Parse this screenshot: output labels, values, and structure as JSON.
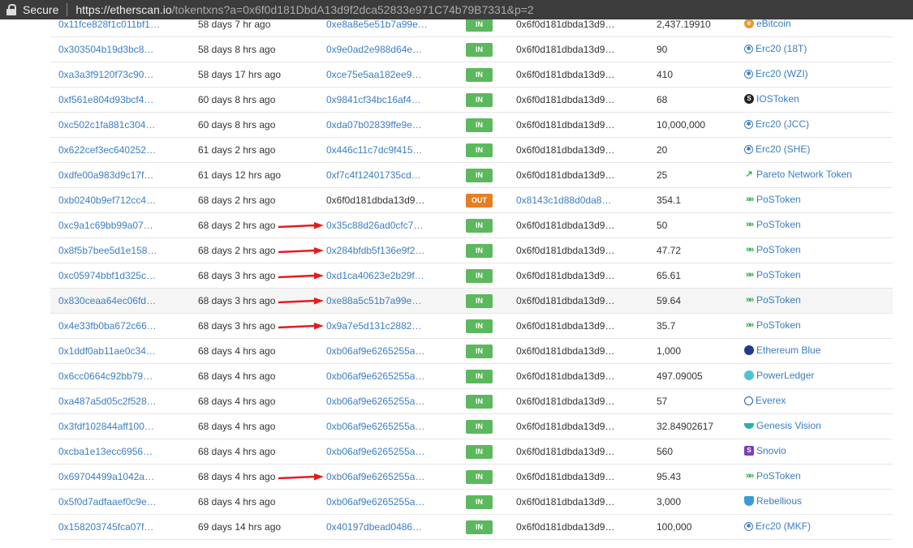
{
  "browser": {
    "secure_label": "Secure",
    "url_host": "https://etherscan.io",
    "url_path": "/tokentxns?a=0x6f0d181DbdA13d9f2dca52833e971C74b79B7331&p=2"
  },
  "transactions": [
    {
      "hash": "0x11fce828f1c011bf1…",
      "age": "58 days 7 hr ago",
      "from": "0xe8a8e5e51b7a99e…",
      "from_link": true,
      "dir": "IN",
      "to": "0x6f0d181dbda13d9…",
      "to_link": false,
      "value": "2,437.19910",
      "token": "eBitcoin",
      "icon": "ebitcoin-icon",
      "arrow": false,
      "hl": false
    },
    {
      "hash": "0x303504b19d3bc8…",
      "age": "58 days 8 hrs ago",
      "from": "0x9e0ad2e988d64e…",
      "from_link": true,
      "dir": "IN",
      "to": "0x6f0d181dbda13d9…",
      "to_link": false,
      "value": "90",
      "token": "Erc20 (18T)",
      "icon": "erc20-icon",
      "arrow": false,
      "hl": false
    },
    {
      "hash": "0xa3a3f9120f73c90…",
      "age": "58 days 17 hrs ago",
      "from": "0xce75e5aa182ee9…",
      "from_link": true,
      "dir": "IN",
      "to": "0x6f0d181dbda13d9…",
      "to_link": false,
      "value": "410",
      "token": "Erc20 (WZI)",
      "icon": "erc20-icon",
      "arrow": false,
      "hl": false
    },
    {
      "hash": "0xf561e804d93bcf4…",
      "age": "60 days 8 hrs ago",
      "from": "0x9841cf34bc16af4…",
      "from_link": true,
      "dir": "IN",
      "to": "0x6f0d181dbda13d9…",
      "to_link": false,
      "value": "68",
      "token": "IOSToken",
      "icon": "iostoken-icon",
      "arrow": false,
      "hl": false
    },
    {
      "hash": "0xc502c1fa881c304…",
      "age": "60 days 8 hrs ago",
      "from": "0xda07b02839ffe9e…",
      "from_link": true,
      "dir": "IN",
      "to": "0x6f0d181dbda13d9…",
      "to_link": false,
      "value": "10,000,000",
      "token": "Erc20 (JCC)",
      "icon": "erc20-icon",
      "arrow": false,
      "hl": false
    },
    {
      "hash": "0x622cef3ec640252…",
      "age": "61 days 2 hrs ago",
      "from": "0x446c11c7dc9f415…",
      "from_link": true,
      "dir": "IN",
      "to": "0x6f0d181dbda13d9…",
      "to_link": false,
      "value": "20",
      "token": "Erc20 (SHE)",
      "icon": "erc20-icon",
      "arrow": false,
      "hl": false
    },
    {
      "hash": "0xdfe00a983d9c17f…",
      "age": "61 days 12 hrs ago",
      "from": "0xf7c4f12401735cd…",
      "from_link": true,
      "dir": "IN",
      "to": "0x6f0d181dbda13d9…",
      "to_link": false,
      "value": "25",
      "token": "Pareto Network Token",
      "icon": "pareto-icon",
      "arrow": false,
      "hl": false
    },
    {
      "hash": "0xb0240b9ef712cc4…",
      "age": "68 days 2 hrs ago",
      "from": "0x6f0d181dbda13d9…",
      "from_link": false,
      "dir": "OUT",
      "to": "0x8143c1d88d0da8…",
      "to_link": true,
      "value": "354.1",
      "token": "PoSToken",
      "icon": "postoken-icon",
      "arrow": false,
      "hl": false
    },
    {
      "hash": "0xc9a1c69bb99a07…",
      "age": "68 days 2 hrs ago",
      "from": "0x35c88d26ad0cfc7…",
      "from_link": true,
      "dir": "IN",
      "to": "0x6f0d181dbda13d9…",
      "to_link": false,
      "value": "50",
      "token": "PoSToken",
      "icon": "postoken-icon",
      "arrow": true,
      "hl": false
    },
    {
      "hash": "0x8f5b7bee5d1e158…",
      "age": "68 days 2 hrs ago",
      "from": "0x284bfdb5f136e9f2…",
      "from_link": true,
      "dir": "IN",
      "to": "0x6f0d181dbda13d9…",
      "to_link": false,
      "value": "47.72",
      "token": "PoSToken",
      "icon": "postoken-icon",
      "arrow": true,
      "hl": false
    },
    {
      "hash": "0xc05974bbf1d325c…",
      "age": "68 days 3 hrs ago",
      "from": "0xd1ca40623e2b29f…",
      "from_link": true,
      "dir": "IN",
      "to": "0x6f0d181dbda13d9…",
      "to_link": false,
      "value": "65.61",
      "token": "PoSToken",
      "icon": "postoken-icon",
      "arrow": true,
      "hl": false
    },
    {
      "hash": "0x830ceaa64ec06fd…",
      "age": "68 days 3 hrs ago",
      "from": "0xe88a5c51b7a99e…",
      "from_link": true,
      "dir": "IN",
      "to": "0x6f0d181dbda13d9…",
      "to_link": false,
      "value": "59.64",
      "token": "PoSToken",
      "icon": "postoken-icon",
      "arrow": true,
      "hl": true
    },
    {
      "hash": "0x4e33fb0ba672c66…",
      "age": "68 days 3 hrs ago",
      "from": "0x9a7e5d131c2882…",
      "from_link": true,
      "dir": "IN",
      "to": "0x6f0d181dbda13d9…",
      "to_link": false,
      "value": "35.7",
      "token": "PoSToken",
      "icon": "postoken-icon",
      "arrow": true,
      "hl": false
    },
    {
      "hash": "0x1ddf0ab11ae0c34…",
      "age": "68 days 4 hrs ago",
      "from": "0xb06af9e6265255a…",
      "from_link": true,
      "dir": "IN",
      "to": "0x6f0d181dbda13d9…",
      "to_link": false,
      "value": "1,000",
      "token": "Ethereum Blue",
      "icon": "ethereum-blue-icon",
      "arrow": false,
      "hl": false
    },
    {
      "hash": "0x6cc0664c92bb79…",
      "age": "68 days 4 hrs ago",
      "from": "0xb06af9e6265255a…",
      "from_link": true,
      "dir": "IN",
      "to": "0x6f0d181dbda13d9…",
      "to_link": false,
      "value": "497.09005",
      "token": "PowerLedger",
      "icon": "powerledger-icon",
      "arrow": false,
      "hl": false
    },
    {
      "hash": "0xa487a5d05c2f528…",
      "age": "68 days 4 hrs ago",
      "from": "0xb06af9e6265255a…",
      "from_link": true,
      "dir": "IN",
      "to": "0x6f0d181dbda13d9…",
      "to_link": false,
      "value": "57",
      "token": "Everex",
      "icon": "everex-icon",
      "arrow": false,
      "hl": false
    },
    {
      "hash": "0x3fdf102844aff100…",
      "age": "68 days 4 hrs ago",
      "from": "0xb06af9e6265255a…",
      "from_link": true,
      "dir": "IN",
      "to": "0x6f0d181dbda13d9…",
      "to_link": false,
      "value": "32.84902617",
      "token": "Genesis Vision",
      "icon": "genesis-vision-icon",
      "arrow": false,
      "hl": false
    },
    {
      "hash": "0xcba1e13ecc6956…",
      "age": "68 days 4 hrs ago",
      "from": "0xb06af9e6265255a…",
      "from_link": true,
      "dir": "IN",
      "to": "0x6f0d181dbda13d9…",
      "to_link": false,
      "value": "560",
      "token": "Snovio",
      "icon": "snovio-icon",
      "arrow": false,
      "hl": false
    },
    {
      "hash": "0x69704499a1042a…",
      "age": "68 days 4 hrs ago",
      "from": "0xb06af9e6265255a…",
      "from_link": true,
      "dir": "IN",
      "to": "0x6f0d181dbda13d9…",
      "to_link": false,
      "value": "95.43",
      "token": "PoSToken",
      "icon": "postoken-icon",
      "arrow": true,
      "hl": false
    },
    {
      "hash": "0x5f0d7adfaaef0c9e…",
      "age": "68 days 4 hrs ago",
      "from": "0xb06af9e6265255a…",
      "from_link": true,
      "dir": "IN",
      "to": "0x6f0d181dbda13d9…",
      "to_link": false,
      "value": "3,000",
      "token": "Rebellious",
      "icon": "rebellious-icon",
      "arrow": false,
      "hl": false
    },
    {
      "hash": "0x158203745fca07f…",
      "age": "69 days 14 hrs ago",
      "from": "0x40197dbead0486…",
      "from_link": true,
      "dir": "IN",
      "to": "0x6f0d181dbda13d9…",
      "to_link": false,
      "value": "100,000",
      "token": "Erc20 (MKF)",
      "icon": "erc20-icon",
      "arrow": false,
      "hl": false
    }
  ],
  "colors": {
    "link": "#3b7dc4",
    "in_badge": "#5cb85c",
    "out_badge": "#e67e22",
    "arrow": "#e21d1d"
  }
}
